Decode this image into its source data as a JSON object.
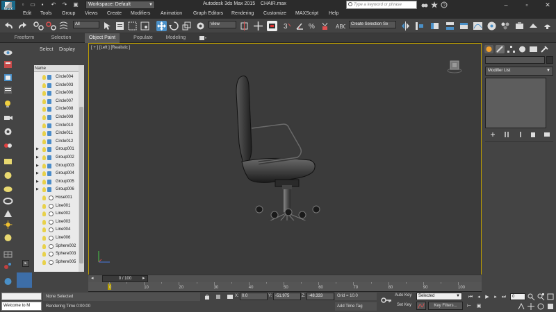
{
  "app": {
    "logo_text": "MAX",
    "title": "Autodesk 3ds Max  2015",
    "file": "CHAIR.max",
    "workspace": "Workspace: Default",
    "search_placeholder": "Type a keyword or phrase"
  },
  "menu": [
    "Edit",
    "Tools",
    "Group",
    "Views",
    "Create",
    "Modifiers",
    "Animation",
    "Graph Editors",
    "Rendering",
    "Customize",
    "MAXScript",
    "Help"
  ],
  "toolbar": {
    "selection_filter": "All",
    "ref_coord": "View",
    "named_selection": "Create Selection Se",
    "snap_number": "3",
    "angle_snap": "2.5"
  },
  "ribbon_tabs": [
    "Freeform",
    "Selection",
    "Object Paint",
    "Populate",
    "Modeling"
  ],
  "explorer": {
    "tabs": [
      "Select",
      "Display"
    ],
    "column_header": "Name",
    "items": [
      {
        "name": "Circle004",
        "type": "shape",
        "expandable": false
      },
      {
        "name": "Circle003",
        "type": "shape",
        "expandable": false
      },
      {
        "name": "Circle006",
        "type": "shape",
        "expandable": false
      },
      {
        "name": "Circle007",
        "type": "shape",
        "expandable": false
      },
      {
        "name": "Circle008",
        "type": "shape",
        "expandable": false
      },
      {
        "name": "Circle009",
        "type": "shape",
        "expandable": false
      },
      {
        "name": "Circle010",
        "type": "shape",
        "expandable": false
      },
      {
        "name": "Circle011",
        "type": "shape",
        "expandable": false
      },
      {
        "name": "Circle012",
        "type": "shape",
        "expandable": false
      },
      {
        "name": "Group001",
        "type": "group",
        "expandable": true
      },
      {
        "name": "Group002",
        "type": "group",
        "expandable": true
      },
      {
        "name": "Group003",
        "type": "group",
        "expandable": true
      },
      {
        "name": "Group004",
        "type": "group",
        "expandable": true
      },
      {
        "name": "Group005",
        "type": "group",
        "expandable": true
      },
      {
        "name": "Group006",
        "type": "group",
        "expandable": true
      },
      {
        "name": "Hose001",
        "type": "geometry",
        "expandable": false
      },
      {
        "name": "Line001",
        "type": "geometry",
        "expandable": false
      },
      {
        "name": "Line002",
        "type": "geometry",
        "expandable": false
      },
      {
        "name": "Line003",
        "type": "geometry",
        "expandable": false
      },
      {
        "name": "Line004",
        "type": "geometry",
        "expandable": false
      },
      {
        "name": "Line006",
        "type": "geometry",
        "expandable": false
      },
      {
        "name": "Sphere002",
        "type": "geometry",
        "expandable": false
      },
      {
        "name": "Sphere003",
        "type": "geometry",
        "expandable": false
      },
      {
        "name": "Sphere005",
        "type": "geometry",
        "expandable": false
      }
    ]
  },
  "viewport": {
    "label": "[ + ] [Left ] [Realistic ]"
  },
  "command_panel": {
    "modifier_list": "Modifier List"
  },
  "timeline": {
    "frame_display": "0 / 100",
    "ticks": [
      "0",
      "10",
      "20",
      "30",
      "40",
      "50",
      "60",
      "70",
      "80",
      "90",
      "100"
    ]
  },
  "status": {
    "maxscript_output": "Welcome to M",
    "selection": "None Selected",
    "prompt": "Rendering Time  0:00:00",
    "x_label": "X:",
    "x_value": "0.0",
    "y_label": "Y:",
    "y_value": "-51.975",
    "z_label": "Z:",
    "z_value": "-48.333",
    "grid": "Grid = 10.0",
    "add_time_tag": "Add Time Tag",
    "auto_key": "Auto Key",
    "set_key": "Set Key",
    "selected": "Selected",
    "key_filters": "Key Filters...",
    "frame": "0"
  },
  "colors": {
    "viewport_border": "#c0a000",
    "explorer_bg": "#eaeaea",
    "active_tab": "#585858"
  }
}
